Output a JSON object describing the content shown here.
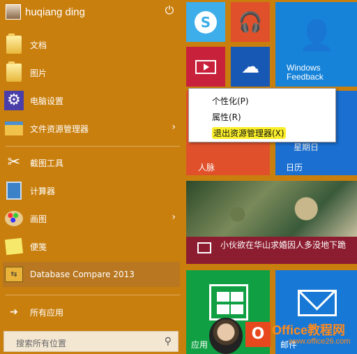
{
  "user": {
    "name": "huqiang ding"
  },
  "menu": {
    "items": [
      {
        "label": "文档",
        "icon": "documents-folder-icon"
      },
      {
        "label": "图片",
        "icon": "pictures-folder-icon"
      },
      {
        "label": "电脑设置",
        "icon": "settings-gear-icon"
      },
      {
        "label": "文件资源管理器",
        "icon": "file-explorer-icon",
        "arrow": "›"
      },
      {
        "label": "截图工具",
        "icon": "snipping-tool-icon"
      },
      {
        "label": "计算器",
        "icon": "calculator-icon"
      },
      {
        "label": "画图",
        "icon": "paint-icon",
        "arrow": "›"
      },
      {
        "label": "便笺",
        "icon": "sticky-notes-icon"
      },
      {
        "label": "Database Compare 2013",
        "icon": "database-compare-icon"
      }
    ],
    "all_apps": "所有应用",
    "search_placeholder": "搜索所有位置"
  },
  "tiles": {
    "feedback_line1": "Windows",
    "feedback_line2": "Feedback",
    "people": "人脉",
    "calendar": "日历",
    "calendar_peek": "星期日",
    "news_headline": "小伙欲在华山求婚因人多没地下跪",
    "store": "应用",
    "mail": "邮件"
  },
  "context_menu": {
    "personalize": "个性化(P)",
    "properties": "属性(R)",
    "exit_explorer": "退出资源管理器(X)"
  },
  "watermark": {
    "brand": "Office教程网",
    "url": "www.office26.com"
  },
  "colors": {
    "start_bg": "#c97f0d",
    "highlight": "#fbef2a"
  }
}
